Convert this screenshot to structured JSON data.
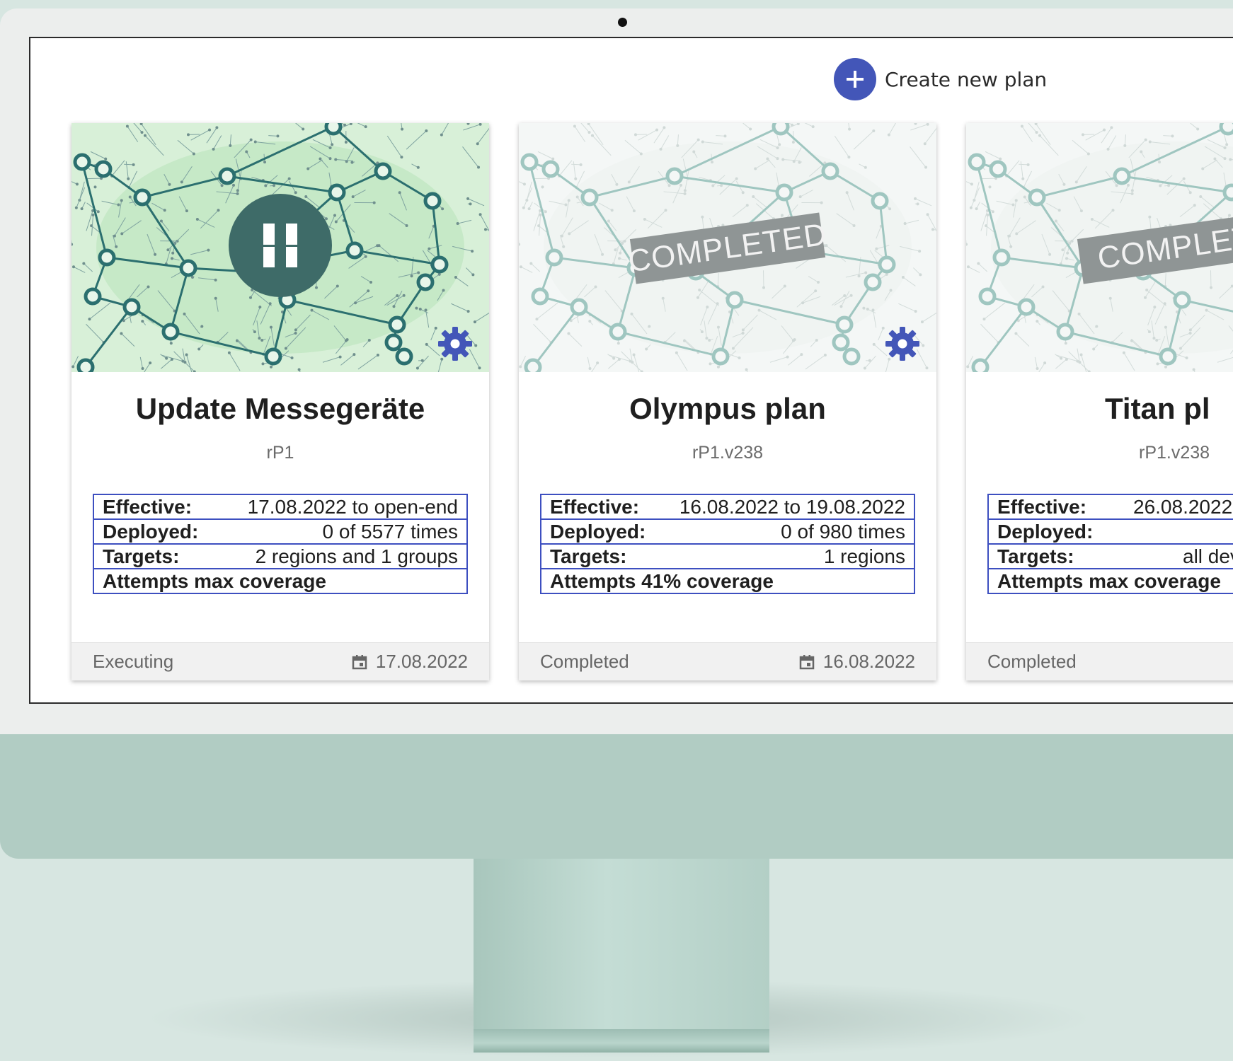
{
  "toolbar": {
    "create_label": "Create new plan"
  },
  "cards": [
    {
      "title": "Update Messegeräte",
      "version": "rP1",
      "state": "executing",
      "rows": [
        {
          "label": "Effective:",
          "value": "17.08.2022 to open-end"
        },
        {
          "label": "Deployed:",
          "value": "0 of 5577 times"
        },
        {
          "label": "Targets:",
          "value": "2 regions and 1 groups"
        },
        {
          "label": "Attempts max coverage",
          "value": ""
        }
      ],
      "status": "Executing",
      "date": "17.08.2022"
    },
    {
      "title": "Olympus plan",
      "version": "rP1.v238",
      "state": "completed",
      "stamp": "COMPLETED",
      "rows": [
        {
          "label": "Effective:",
          "value": "16.08.2022 to 19.08.2022"
        },
        {
          "label": "Deployed:",
          "value": "0 of 980 times"
        },
        {
          "label": "Targets:",
          "value": "1 regions"
        },
        {
          "label": "Attempts 41% coverage",
          "value": ""
        }
      ],
      "status": "Completed",
      "date": "16.08.2022"
    },
    {
      "title": "Titan pl",
      "version": "rP1.v238",
      "state": "completed",
      "stamp": "COMPLET",
      "rows": [
        {
          "label": "Effective:",
          "value": "26.08.2022"
        },
        {
          "label": "Deployed:",
          "value": ""
        },
        {
          "label": "Targets:",
          "value": "all dev"
        },
        {
          "label": "Attempts max coverage",
          "value": ""
        }
      ],
      "status": "Completed",
      "date": ""
    }
  ],
  "colors": {
    "accent": "#4356b8",
    "table_border": "#3d4fc0",
    "network_dark": "#2b6f6f",
    "network_bg": "#d8f0d8",
    "pause_bg": "#3e6b68",
    "stamp_bg": "#8f9595",
    "device_body": "#b1ccc3",
    "background": "#d7e6e1"
  }
}
